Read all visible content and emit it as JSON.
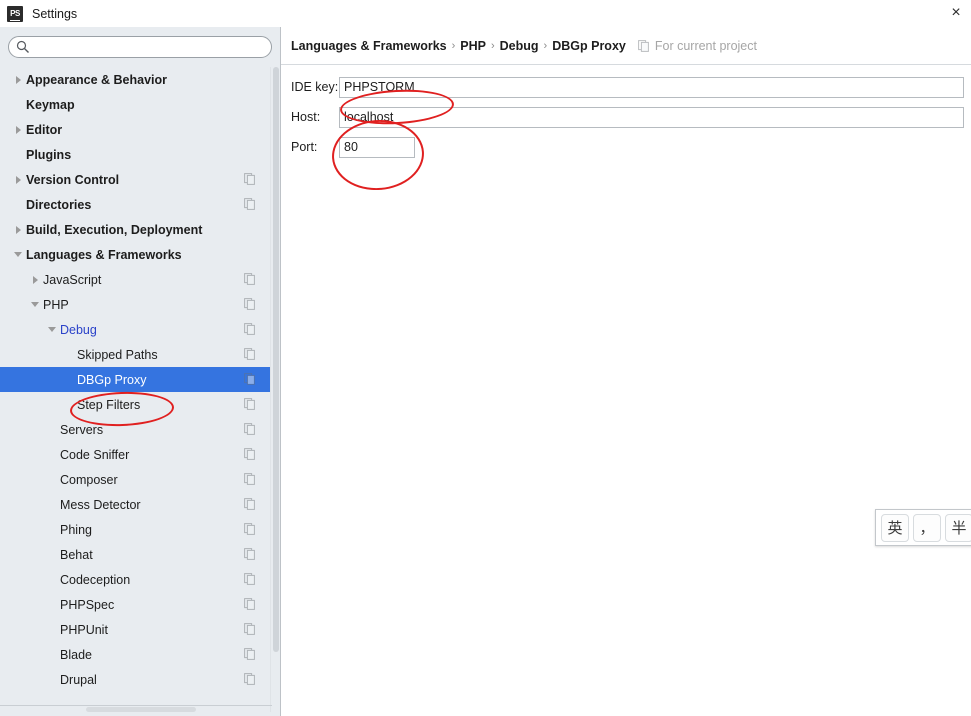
{
  "window": {
    "title": "Settings",
    "app_icon": "phpstorm-logo-icon",
    "close_label": "×"
  },
  "search": {
    "value": "",
    "placeholder": "",
    "icon": "search-icon"
  },
  "sidebar": {
    "items": [
      {
        "label": "Appearance & Behavior",
        "indent": 0,
        "bold": true,
        "arrow": "right",
        "copy": false,
        "selected": false,
        "blue": false
      },
      {
        "label": "Keymap",
        "indent": 0,
        "bold": true,
        "arrow": "none",
        "copy": false,
        "selected": false,
        "blue": false
      },
      {
        "label": "Editor",
        "indent": 0,
        "bold": true,
        "arrow": "right",
        "copy": false,
        "selected": false,
        "blue": false
      },
      {
        "label": "Plugins",
        "indent": 0,
        "bold": true,
        "arrow": "none",
        "copy": false,
        "selected": false,
        "blue": false
      },
      {
        "label": "Version Control",
        "indent": 0,
        "bold": true,
        "arrow": "right",
        "copy": true,
        "selected": false,
        "blue": false
      },
      {
        "label": "Directories",
        "indent": 0,
        "bold": true,
        "arrow": "none",
        "copy": true,
        "selected": false,
        "blue": false
      },
      {
        "label": "Build, Execution, Deployment",
        "indent": 0,
        "bold": true,
        "arrow": "right",
        "copy": false,
        "selected": false,
        "blue": false
      },
      {
        "label": "Languages & Frameworks",
        "indent": 0,
        "bold": true,
        "arrow": "down",
        "copy": false,
        "selected": false,
        "blue": false
      },
      {
        "label": "JavaScript",
        "indent": 1,
        "bold": false,
        "arrow": "right",
        "copy": true,
        "selected": false,
        "blue": false
      },
      {
        "label": "PHP",
        "indent": 1,
        "bold": false,
        "arrow": "down",
        "copy": true,
        "selected": false,
        "blue": false
      },
      {
        "label": "Debug",
        "indent": 2,
        "bold": false,
        "arrow": "down",
        "copy": true,
        "selected": false,
        "blue": true
      },
      {
        "label": "Skipped Paths",
        "indent": 3,
        "bold": false,
        "arrow": "none",
        "copy": true,
        "selected": false,
        "blue": false
      },
      {
        "label": "DBGp Proxy",
        "indent": 3,
        "bold": false,
        "arrow": "none",
        "copy": true,
        "selected": true,
        "blue": false
      },
      {
        "label": "Step Filters",
        "indent": 3,
        "bold": false,
        "arrow": "none",
        "copy": true,
        "selected": false,
        "blue": false
      },
      {
        "label": "Servers",
        "indent": 2,
        "bold": false,
        "arrow": "none",
        "copy": true,
        "selected": false,
        "blue": false
      },
      {
        "label": "Code Sniffer",
        "indent": 2,
        "bold": false,
        "arrow": "none",
        "copy": true,
        "selected": false,
        "blue": false
      },
      {
        "label": "Composer",
        "indent": 2,
        "bold": false,
        "arrow": "none",
        "copy": true,
        "selected": false,
        "blue": false
      },
      {
        "label": "Mess Detector",
        "indent": 2,
        "bold": false,
        "arrow": "none",
        "copy": true,
        "selected": false,
        "blue": false
      },
      {
        "label": "Phing",
        "indent": 2,
        "bold": false,
        "arrow": "none",
        "copy": true,
        "selected": false,
        "blue": false
      },
      {
        "label": "Behat",
        "indent": 2,
        "bold": false,
        "arrow": "none",
        "copy": true,
        "selected": false,
        "blue": false
      },
      {
        "label": "Codeception",
        "indent": 2,
        "bold": false,
        "arrow": "none",
        "copy": true,
        "selected": false,
        "blue": false
      },
      {
        "label": "PHPSpec",
        "indent": 2,
        "bold": false,
        "arrow": "none",
        "copy": true,
        "selected": false,
        "blue": false
      },
      {
        "label": "PHPUnit",
        "indent": 2,
        "bold": false,
        "arrow": "none",
        "copy": true,
        "selected": false,
        "blue": false
      },
      {
        "label": "Blade",
        "indent": 2,
        "bold": false,
        "arrow": "none",
        "copy": true,
        "selected": false,
        "blue": false
      },
      {
        "label": "Drupal",
        "indent": 2,
        "bold": false,
        "arrow": "none",
        "copy": true,
        "selected": false,
        "blue": false
      }
    ]
  },
  "breadcrumb": {
    "crumbs": [
      "Languages & Frameworks",
      "PHP",
      "Debug",
      "DBGp Proxy"
    ],
    "separator": "›",
    "scope_label": "For current project",
    "scope_icon": "copy-settings-icon"
  },
  "form": {
    "fields": [
      {
        "label": "IDE key:",
        "value": "PHPSTORM",
        "width": "wide",
        "name": "ide-key"
      },
      {
        "label": "Host:",
        "value": "localhost",
        "width": "wide",
        "name": "host"
      },
      {
        "label": "Port:",
        "value": "80",
        "width": "narrow",
        "name": "port"
      }
    ]
  },
  "annotations": {
    "color": "#e02020",
    "ellipses": [
      "ide-key-value",
      "host-and-port-values",
      "dbgp-proxy-tree-item"
    ]
  },
  "ime": {
    "buttons": [
      "英",
      "，",
      "半"
    ],
    "button_names": [
      "ime-language-toggle",
      "ime-punctuation-toggle",
      "ime-width-toggle"
    ]
  },
  "colors": {
    "selection_blue": "#3574e0",
    "panel_background": "#e8ecf0",
    "content_background": "#ffffff",
    "annotation_red": "#e02020",
    "link_blue": "#2a42c9"
  }
}
